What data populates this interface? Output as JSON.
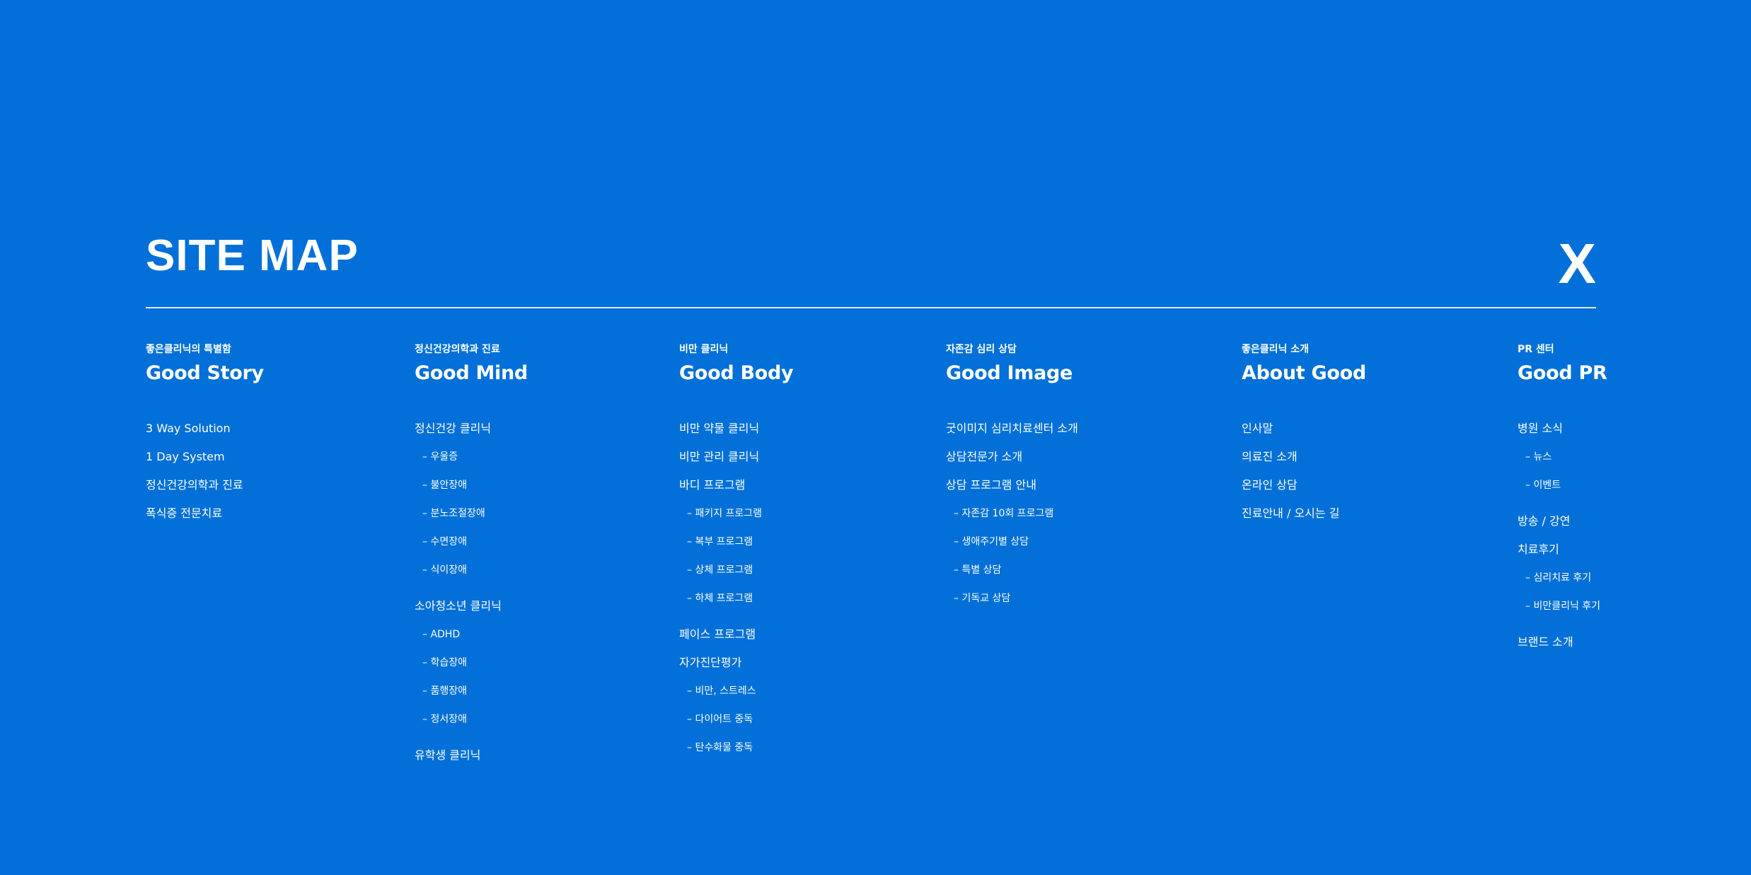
{
  "header": {
    "title": "SITE MAP",
    "close_label": "X"
  },
  "columns": [
    {
      "subtitle": "좋은클리닉의 특별함",
      "title": "Good Story",
      "items": [
        {
          "label": "3 Way Solution",
          "level": "main"
        },
        {
          "label": "1 Day System",
          "level": "main"
        },
        {
          "label": "정신건강의학과 진료",
          "level": "main"
        },
        {
          "label": "폭식증 전문치료",
          "level": "main"
        }
      ]
    },
    {
      "subtitle": "정신건강의학과 진료",
      "title": "Good Mind",
      "items": [
        {
          "label": "정신건강 클리닉",
          "level": "main"
        },
        {
          "label": "– 우울증",
          "level": "sub"
        },
        {
          "label": "– 불안장애",
          "level": "sub"
        },
        {
          "label": "– 분노조절장애",
          "level": "sub"
        },
        {
          "label": "– 수면장애",
          "level": "sub"
        },
        {
          "label": "– 식이장애",
          "level": "sub"
        },
        {
          "label": "소아청소년 클리닉",
          "level": "main"
        },
        {
          "label": "– ADHD",
          "level": "sub"
        },
        {
          "label": "– 학습장애",
          "level": "sub"
        },
        {
          "label": "– 품행장애",
          "level": "sub"
        },
        {
          "label": "– 정서장애",
          "level": "sub"
        },
        {
          "label": "유학생 클리닉",
          "level": "main"
        }
      ]
    },
    {
      "subtitle": "비만 클리닉",
      "title": "Good Body",
      "items": [
        {
          "label": "비만 약물 클리닉",
          "level": "main"
        },
        {
          "label": "비만 관리 클리닉",
          "level": "main"
        },
        {
          "label": "바디 프로그램",
          "level": "main"
        },
        {
          "label": "– 패키지 프로그램",
          "level": "sub"
        },
        {
          "label": "– 복부 프로그램",
          "level": "sub"
        },
        {
          "label": "– 상체 프로그램",
          "level": "sub"
        },
        {
          "label": "– 하체 프로그램",
          "level": "sub"
        },
        {
          "label": "페이스 프로그램",
          "level": "main"
        },
        {
          "label": "자가진단평가",
          "level": "main"
        },
        {
          "label": "– 비만, 스트레스",
          "level": "sub"
        },
        {
          "label": "– 다이어트 중독",
          "level": "sub"
        },
        {
          "label": "– 탄수화물 중독",
          "level": "sub"
        }
      ]
    },
    {
      "subtitle": "자존감 심리 상담",
      "title": "Good Image",
      "items": [
        {
          "label": "굿이미지 심리치료센터 소개",
          "level": "main"
        },
        {
          "label": "상담전문가 소개",
          "level": "main"
        },
        {
          "label": "상담 프로그램 안내",
          "level": "main"
        },
        {
          "label": "– 자존감 10회 프로그램",
          "level": "sub"
        },
        {
          "label": "– 생애주기별 상담",
          "level": "sub"
        },
        {
          "label": "– 특별 상담",
          "level": "sub"
        },
        {
          "label": "– 기독교 상담",
          "level": "sub"
        }
      ]
    },
    {
      "subtitle": "좋은클리닉 소개",
      "title": "About Good",
      "items": [
        {
          "label": "인사말",
          "level": "main"
        },
        {
          "label": "의료진 소개",
          "level": "main"
        },
        {
          "label": "온라인 상담",
          "level": "main"
        },
        {
          "label": "진료안내 / 오시는 길",
          "level": "main"
        }
      ]
    },
    {
      "subtitle": "PR 센터",
      "title": "Good PR",
      "items": [
        {
          "label": "병원 소식",
          "level": "main"
        },
        {
          "label": "– 뉴스",
          "level": "sub"
        },
        {
          "label": "– 이벤트",
          "level": "sub"
        },
        {
          "label": "방송 / 강연",
          "level": "main"
        },
        {
          "label": "치료후기",
          "level": "main"
        },
        {
          "label": "– 심리치료 후기",
          "level": "sub"
        },
        {
          "label": "– 비만클리닉 후기",
          "level": "sub"
        },
        {
          "label": "브랜드 소개",
          "level": "main"
        }
      ]
    }
  ],
  "colors": {
    "background": "#0270d8",
    "text": "#ffffff"
  }
}
